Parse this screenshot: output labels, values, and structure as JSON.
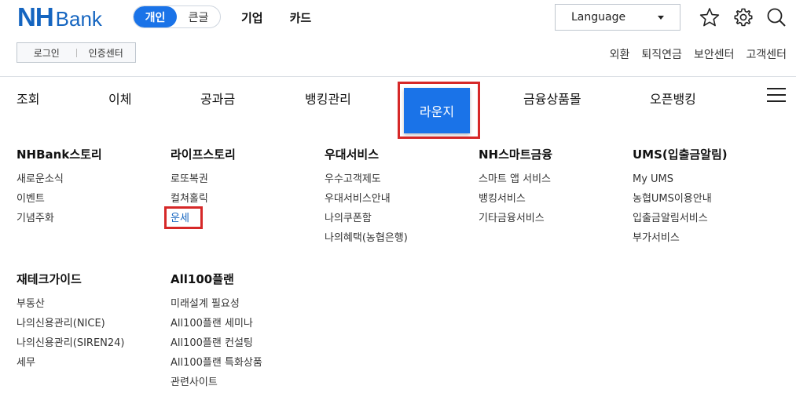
{
  "brand": {
    "nh": "NH",
    "bank": "Bank",
    "color": "#1565c0"
  },
  "segment": {
    "personal": "개인",
    "large": "큰글"
  },
  "top_nav": [
    "기업",
    "카드"
  ],
  "language": {
    "label": "Language"
  },
  "auth": {
    "login": "로그인",
    "cert": "인증센터"
  },
  "utility": [
    "외환",
    "퇴직연금",
    "보안센터",
    "고객센터"
  ],
  "main_nav": [
    "조회",
    "이체",
    "공과금",
    "뱅킹관리",
    "라운지",
    "금융상품몰",
    "오픈뱅킹"
  ],
  "active_main": "라운지",
  "accent": "#1a73e8",
  "highlight": "#d62828",
  "menu": [
    {
      "title": "NHBank스토리",
      "items": [
        "새로운소식",
        "이벤트",
        "기념주화"
      ]
    },
    {
      "title": "라이프스토리",
      "items": [
        "로또복권",
        "컬쳐홀릭",
        "운세"
      ]
    },
    {
      "title": "우대서비스",
      "items": [
        "우수고객제도",
        "우대서비스안내",
        "나의쿠폰함",
        "나의혜택(농협은행)"
      ]
    },
    {
      "title": "NH스마트금융",
      "items": [
        "스마트 앱 서비스",
        "뱅킹서비스",
        "기타금융서비스"
      ]
    },
    {
      "title": "UMS(입출금알림)",
      "items": [
        "My UMS",
        "농협UMS이용안내",
        "입출금알림서비스",
        "부가서비스"
      ]
    },
    {
      "title": "재테크가이드",
      "items": [
        "부동산",
        "나의신용관리(NICE)",
        "나의신용관리(SIREN24)",
        "세무"
      ]
    },
    {
      "title": "All100플랜",
      "items": [
        "미래설계 필요성",
        "All100플랜 세미나",
        "All100플랜 컨설팅",
        "All100플랜 특화상품",
        "관련사이트"
      ]
    }
  ],
  "icons": {
    "favorite": "star-icon",
    "settings": "gear-icon",
    "search": "search-icon",
    "menu": "hamburger-icon"
  }
}
